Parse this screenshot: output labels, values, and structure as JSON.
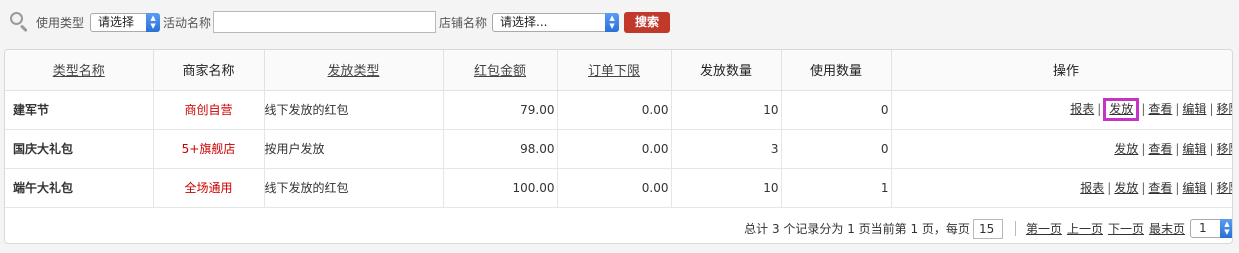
{
  "filters": {
    "usage_type_label": "使用类型",
    "usage_type_value": "请选择",
    "activity_name_label": "活动名称",
    "activity_name_value": "",
    "store_name_label": "店铺名称",
    "store_name_value": "请选择...",
    "search_label": "搜索"
  },
  "table": {
    "headers": [
      "类型名称",
      "商家名称",
      "发放类型",
      "红包金额",
      "订单下限",
      "发放数量",
      "使用数量",
      "操作"
    ],
    "rows": [
      {
        "name": "建军节",
        "merchant": "商创自营",
        "issue_type": "线下发放的红包",
        "amount": "79.00",
        "min_order": "0.00",
        "issued": "10",
        "used": "0",
        "actions": [
          "报表",
          "发放",
          "查看",
          "编辑",
          "移除"
        ]
      },
      {
        "name": "国庆大礼包",
        "merchant": "5+旗舰店",
        "issue_type": "按用户发放",
        "amount": "98.00",
        "min_order": "0.00",
        "issued": "3",
        "used": "0",
        "actions": [
          "发放",
          "查看",
          "编辑",
          "移除"
        ]
      },
      {
        "name": "端午大礼包",
        "merchant": "全场通用",
        "issue_type": "线下发放的红包",
        "amount": "100.00",
        "min_order": "0.00",
        "issued": "10",
        "used": "1",
        "actions": [
          "报表",
          "发放",
          "查看",
          "编辑",
          "移除"
        ]
      }
    ]
  },
  "pagination": {
    "summary": "总计 3 个记录分为 1 页当前第 1 页，每页",
    "page_size": "15",
    "first": "第一页",
    "prev": "上一页",
    "next": "下一页",
    "last": "最末页",
    "current_page": "1"
  },
  "colors": {
    "search_button": "#c0392b",
    "merchant_text": "#cc0000",
    "highlight_border": "#c535c5"
  }
}
